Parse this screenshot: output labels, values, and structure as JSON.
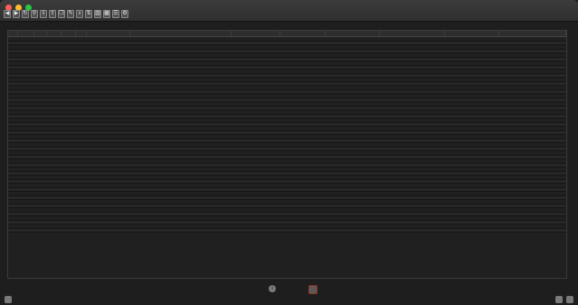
{
  "window": {
    "title": ""
  },
  "colors": {
    "close": "#ff5f57",
    "minimize": "#febc2e",
    "zoom": "#28c840",
    "background": "#1e1e1e",
    "row_alt": "#272727",
    "delete_outline": "#c0392b"
  },
  "toolbar": {
    "tools": [
      {
        "icon": "back-icon",
        "glyph": "◀"
      },
      {
        "icon": "forward-icon",
        "glyph": "▶"
      },
      {
        "icon": "reload-icon",
        "glyph": "↻"
      },
      {
        "icon": "filter-icon",
        "glyph": "⚲"
      },
      {
        "icon": "import-icon",
        "glyph": "⇩"
      },
      {
        "icon": "export-icon",
        "glyph": "⇧"
      },
      {
        "icon": "copy-icon",
        "glyph": "❐"
      },
      {
        "icon": "edit-icon",
        "glyph": "✎"
      },
      {
        "icon": "search-icon",
        "glyph": "⌕"
      },
      {
        "icon": "sort-icon",
        "glyph": "⇅"
      },
      {
        "icon": "columns-icon",
        "glyph": "▥"
      },
      {
        "icon": "grid-icon",
        "glyph": "▦"
      },
      {
        "icon": "list-icon",
        "glyph": "☰"
      },
      {
        "icon": "settings-icon",
        "glyph": "⚙"
      }
    ]
  },
  "section_label": "",
  "table": {
    "columns": [
      {
        "key": "c1",
        "label": ""
      },
      {
        "key": "c2",
        "label": ""
      },
      {
        "key": "c3",
        "label": ""
      },
      {
        "key": "c4",
        "label": ""
      },
      {
        "key": "c5",
        "label": ""
      },
      {
        "key": "c6",
        "label": ""
      },
      {
        "key": "c7",
        "label": ""
      },
      {
        "key": "c8",
        "label": ""
      },
      {
        "key": "c9",
        "label": ""
      },
      {
        "key": "c10",
        "label": ""
      },
      {
        "key": "c11",
        "label": ""
      },
      {
        "key": "c12",
        "label": ""
      },
      {
        "key": "c13",
        "label": ""
      },
      {
        "key": "c14",
        "label": ""
      }
    ],
    "row_count": 48,
    "rows": []
  },
  "statusbar": {
    "text": "",
    "buttons": [
      {
        "icon": "lock-icon"
      },
      {
        "icon": "info-icon"
      },
      {
        "icon": "trash-icon"
      },
      {
        "icon": "sidebar-icon"
      },
      {
        "icon": "expand-icon"
      }
    ]
  }
}
